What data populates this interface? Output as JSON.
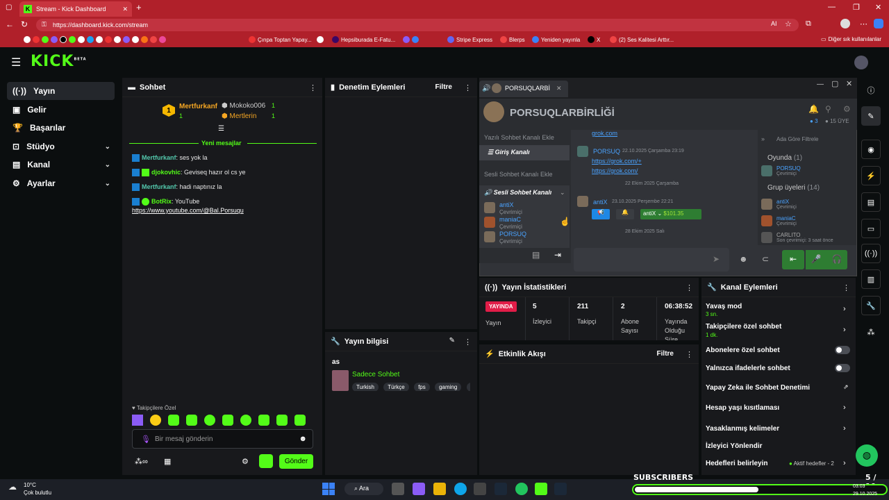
{
  "browser": {
    "tab_title": "Stream - Kick Dashboard",
    "url": "https://dashboard.kick.com/stream",
    "bookmarks": [
      "Çınpa Toptan Yapay...",
      "Hepsiburada E-Fatu...",
      "Stripe Express",
      "Blerps",
      "Yeniden yayınla",
      "X",
      "(2) Ses Kalitesi Arttır...",
      "Diğer sık kullanılanlar"
    ],
    "ai_label": "AI"
  },
  "logo": {
    "text": "KICK",
    "beta": "BETA"
  },
  "sidebar": {
    "items": [
      {
        "label": "Yayın",
        "icon": "broadcast-icon"
      },
      {
        "label": "Gelir",
        "icon": "revenue-icon"
      },
      {
        "label": "Başarılar",
        "icon": "trophy-icon"
      },
      {
        "label": "Stüdyo",
        "icon": "studio-icon"
      },
      {
        "label": "Kanal",
        "icon": "channel-icon"
      },
      {
        "label": "Ayarlar",
        "icon": "settings-icon"
      }
    ]
  },
  "chat": {
    "title": "Sohbet",
    "leaders": [
      {
        "rank": "1",
        "name": "Mertfurkanf",
        "count": "1"
      },
      {
        "name": "Mokoko006",
        "count": "1"
      },
      {
        "name": "Mertlerin",
        "count": "1"
      }
    ],
    "new_messages": "Yeni mesajlar",
    "messages": [
      {
        "user": "Mertfurkanf",
        "text": ": ses yok la",
        "color": "#53c9ad"
      },
      {
        "user": "djokovhic",
        "text": ": Geviseq hazır ol cs ye",
        "color": "#53fc18"
      },
      {
        "user": "Mertfurkanf",
        "text": ": hadi naptınız la",
        "color": "#53c9ad"
      },
      {
        "user": "BotRix",
        "text": ": YouTube",
        "color": "#53fc18"
      }
    ],
    "link": "https://www.youtube.com/@Bal.Porsuqu",
    "followers_only": "Takipçilere Özel",
    "input_placeholder": "Bir mesaj gönderin",
    "send": "Gönder"
  },
  "mod": {
    "title": "Denetim Eylemleri",
    "filter": "Filtre"
  },
  "stream_info": {
    "title": "Yayın bilgisi",
    "stream_title": "as",
    "category": "Sadece Sohbet",
    "tags": [
      "Turkish",
      "Türkçe",
      "fps",
      "gaming",
      "m"
    ]
  },
  "discord": {
    "tab": "PORSUQLARBİ",
    "server": "PORSUQLARBİRLİĞİ",
    "online": "3",
    "members": "15 ÜYE",
    "text_channel_add": "Yazılı Sohbet Kanalı Ekle",
    "entry_channel": "Giriş Kanalı",
    "voice_channel_add": "Sesli Sohbet Kanalı Ekle",
    "voice_channel": "Sesli Sohbet Kanalı",
    "voice_users": [
      {
        "name": "antiX",
        "status": "Çevrimiçi"
      },
      {
        "name": "maniaC",
        "status": "Çevrimiçi"
      },
      {
        "name": "PORSUQ",
        "status": "Çevrimiçi"
      }
    ],
    "msgs": {
      "grok1": "grok.com",
      "porsuq_name": "PORSUQ",
      "porsuq_time": "22.10.2025 Çarşamba 23:19",
      "link1": "https://grok.com/+",
      "link2": "https://grok.com/",
      "date_divider": "22 Ekim 2025 Çarşamba",
      "antix_name": "antiX",
      "antix_time": "23.10.2025 Perşembe 22:21",
      "antix_tag": "antiX",
      "antix_amount": "$101.35",
      "date_divider2": "28 Ekim 2025 Salı"
    },
    "search": "Ada Göre Filtrele",
    "ingame": "Oyunda",
    "ingame_count": "(1)",
    "ingame_user": "PORSUQ",
    "ingame_status": "Çevrimiçi",
    "group": "Grup üyeleri",
    "group_count": "(14)",
    "group_users": [
      {
        "name": "antiX",
        "status": "Çevrimiçi"
      },
      {
        "name": "maniaC",
        "status": "Çevrimiçi"
      },
      {
        "name": "CARLITO",
        "status": "Son çevrimiçi: 3 saat önce"
      }
    ]
  },
  "stats": {
    "title": "Yayın İstatistikleri",
    "live": "YAYINDA",
    "live_label": "Yayın",
    "viewers": "5",
    "viewers_label": "İzleyici",
    "followers": "211",
    "followers_label": "Takipçi",
    "subs": "2",
    "subs_label": "Abone Sayısı",
    "duration": "06:38:52",
    "duration_label": "Yayında Olduğu Süre"
  },
  "activity": {
    "title": "Etkinlik Akışı",
    "filter": "Filtre"
  },
  "channel_actions": {
    "title": "Kanal Eylemleri",
    "rows": [
      {
        "label": "Yavaş mod",
        "sub": "3 sn."
      },
      {
        "label": "Takipçilere özel sohbet",
        "sub": "1 dk."
      },
      {
        "label": "Abonelere özel sohbet"
      },
      {
        "label": "Yalnızca ifadelerle sohbet"
      },
      {
        "label": "Yapay Zeka ile Sohbet Denetimi"
      },
      {
        "label": "Hesap yaşı kısıtlaması"
      },
      {
        "label": "Yasaklanmış kelimeler"
      },
      {
        "label": "İzleyici Yönlendir"
      },
      {
        "label": "Hedefleri belirleyin",
        "extra": "Aktif hedefler - 2"
      }
    ]
  },
  "overlay": {
    "subscribers": "SUBSCRIBERS",
    "count": "5 / 10",
    "progress": 0.5
  },
  "taskbar": {
    "weather_temp": "10°C",
    "weather_desc": "Çok bulutlu",
    "search": "Ara",
    "time": "03:03",
    "date": "29.10.2025"
  }
}
